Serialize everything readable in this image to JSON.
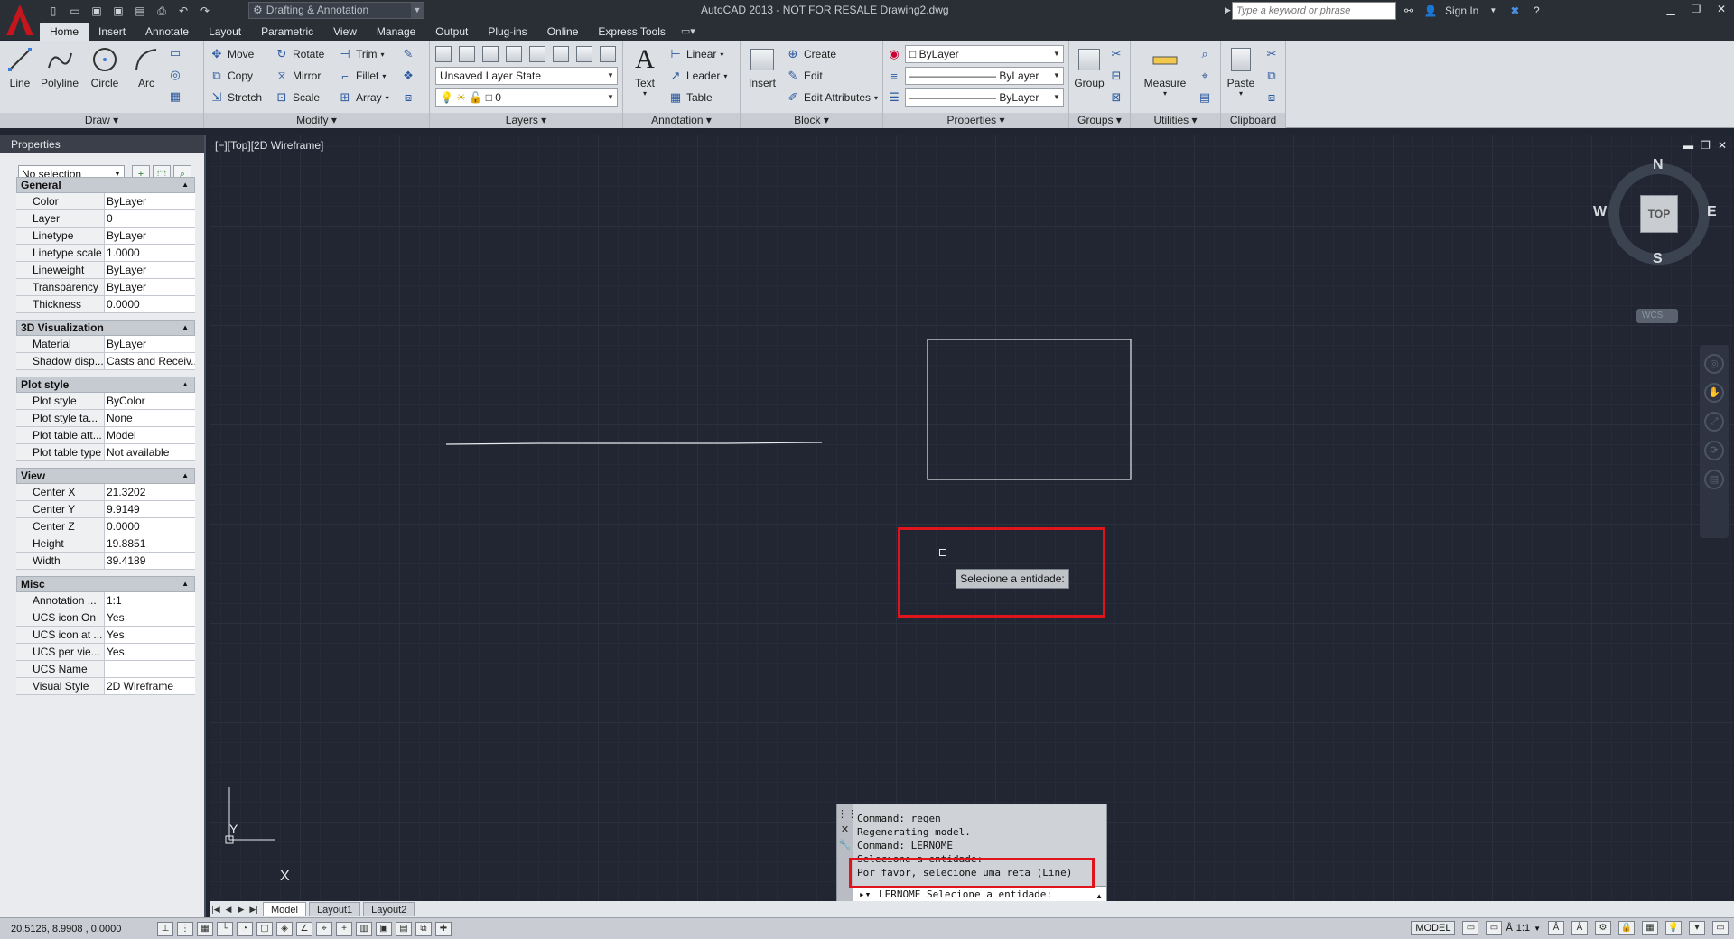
{
  "titlebar": {
    "workspace": "Drafting & Annotation",
    "title": "AutoCAD 2013 - NOT FOR RESALE    Drawing2.dwg",
    "search_placeholder": "Type a keyword or phrase",
    "sign_in": "Sign In"
  },
  "tabs": [
    "Home",
    "Insert",
    "Annotate",
    "Layout",
    "Parametric",
    "View",
    "Manage",
    "Output",
    "Plug-ins",
    "Online",
    "Express Tools"
  ],
  "ribbon": {
    "draw": {
      "title": "Draw",
      "line": "Line",
      "polyline": "Polyline",
      "circle": "Circle",
      "arc": "Arc"
    },
    "modify": {
      "title": "Modify",
      "move": "Move",
      "rotate": "Rotate",
      "trim": "Trim",
      "copy": "Copy",
      "mirror": "Mirror",
      "fillet": "Fillet",
      "stretch": "Stretch",
      "scale": "Scale",
      "array": "Array"
    },
    "layers": {
      "title": "Layers",
      "layer_state": "Unsaved Layer State",
      "current_layer": "0"
    },
    "annotation": {
      "title": "Annotation",
      "text": "Text",
      "linear": "Linear",
      "leader": "Leader",
      "table": "Table"
    },
    "block": {
      "title": "Block",
      "insert": "Insert",
      "create": "Create",
      "edit": "Edit",
      "edit_attributes": "Edit Attributes"
    },
    "properties": {
      "title": "Properties",
      "color": "ByLayer",
      "linetype": "ByLayer",
      "lineweight": "ByLayer"
    },
    "groups": {
      "title": "Groups",
      "group": "Group"
    },
    "utilities": {
      "title": "Utilities",
      "measure": "Measure"
    },
    "clipboard": {
      "title": "Clipboard",
      "paste": "Paste"
    }
  },
  "properties": {
    "header": "Properties",
    "selection": "No selection",
    "sections": [
      {
        "title": "General",
        "rows": [
          {
            "k": "Color",
            "v": "ByLayer"
          },
          {
            "k": "Layer",
            "v": "0"
          },
          {
            "k": "Linetype",
            "v": "ByLayer"
          },
          {
            "k": "Linetype scale",
            "v": "1.0000"
          },
          {
            "k": "Lineweight",
            "v": "ByLayer"
          },
          {
            "k": "Transparency",
            "v": "ByLayer"
          },
          {
            "k": "Thickness",
            "v": "0.0000"
          }
        ]
      },
      {
        "title": "3D Visualization",
        "rows": [
          {
            "k": "Material",
            "v": "ByLayer"
          },
          {
            "k": "Shadow disp...",
            "v": "Casts and Receiv..."
          }
        ]
      },
      {
        "title": "Plot style",
        "rows": [
          {
            "k": "Plot style",
            "v": "ByColor"
          },
          {
            "k": "Plot style ta...",
            "v": "None"
          },
          {
            "k": "Plot table att...",
            "v": "Model"
          },
          {
            "k": "Plot table type",
            "v": "Not available"
          }
        ]
      },
      {
        "title": "View",
        "rows": [
          {
            "k": "Center X",
            "v": "21.3202"
          },
          {
            "k": "Center Y",
            "v": "9.9149"
          },
          {
            "k": "Center Z",
            "v": "0.0000"
          },
          {
            "k": "Height",
            "v": "19.8851"
          },
          {
            "k": "Width",
            "v": "39.4189"
          }
        ]
      },
      {
        "title": "Misc",
        "rows": [
          {
            "k": "Annotation ...",
            "v": "1:1"
          },
          {
            "k": "UCS icon On",
            "v": "Yes"
          },
          {
            "k": "UCS icon at ...",
            "v": "Yes"
          },
          {
            "k": "UCS per vie...",
            "v": "Yes"
          },
          {
            "k": "UCS Name",
            "v": ""
          },
          {
            "k": "Visual Style",
            "v": "2D Wireframe"
          }
        ]
      }
    ]
  },
  "viewport": {
    "label": "[−][Top][2D Wireframe]",
    "tooltip": "Selecione a entidade:",
    "compass": {
      "n": "N",
      "s": "S",
      "e": "E",
      "w": "W",
      "top": "TOP",
      "wcs": "WCS"
    },
    "ucs_x": "X",
    "ucs_y": "Y"
  },
  "command": {
    "history": [
      "Command: regen",
      "Regenerating model.",
      "Command: LERNOME",
      "Selecione a entidade:",
      "Por favor, selecione uma reta (Line)"
    ],
    "input": "LERNOME Selecione a entidade:"
  },
  "layout_tabs": [
    "Model",
    "Layout1",
    "Layout2"
  ],
  "status": {
    "coords": "20.5126, 8.9908 , 0.0000",
    "model": "MODEL",
    "scale": "1:1"
  },
  "colors": {
    "accent_red": "#e0151b",
    "canvas": "#212632"
  }
}
